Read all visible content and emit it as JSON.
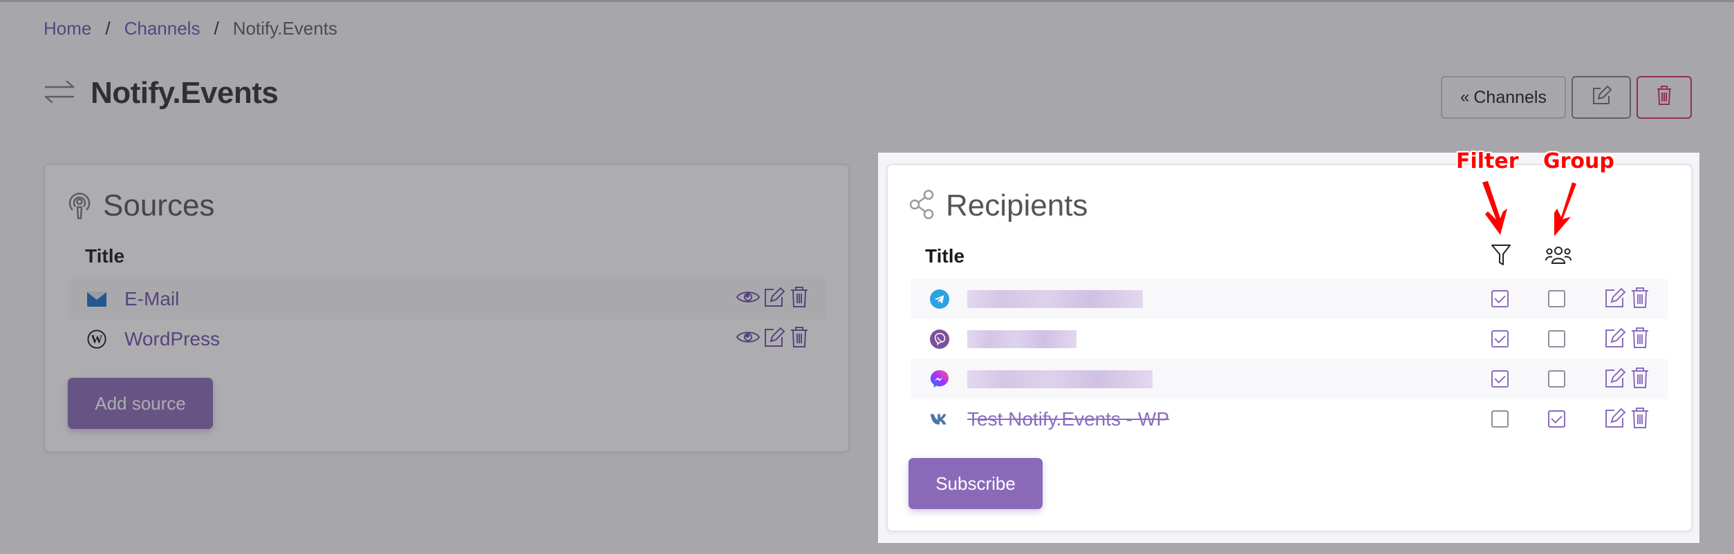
{
  "breadcrumb": {
    "items": [
      {
        "label": "Home",
        "link": true
      },
      {
        "label": "Channels",
        "link": true
      },
      {
        "label": "Notify.Events",
        "link": false
      }
    ],
    "separator": "/"
  },
  "page": {
    "title": "Notify.Events",
    "title_icon": "arrows-exchange-icon"
  },
  "toolbar": {
    "back_label": "Channels",
    "back_icon": "double-chevron-left-icon",
    "edit_icon": "edit-icon",
    "delete_icon": "trash-icon",
    "delete_color": "#d32b74"
  },
  "sources": {
    "heading": "Sources",
    "heading_icon": "broadcast-icon",
    "column_title": "Title",
    "rows": [
      {
        "title": "E-Mail",
        "icon": "envelope-icon",
        "actions": [
          "view",
          "edit",
          "delete"
        ]
      },
      {
        "title": "WordPress",
        "icon": "wordpress-icon",
        "actions": [
          "view",
          "edit",
          "delete"
        ]
      }
    ],
    "add_button": "Add source"
  },
  "recipients": {
    "heading": "Recipients",
    "heading_icon": "share-nodes-icon",
    "column_title": "Title",
    "filter_column_icon": "filter-funnel-icon",
    "group_column_icon": "users-group-icon",
    "rows": [
      {
        "icon": "telegram-icon",
        "title": "",
        "title_blurred": true,
        "filter": true,
        "group": false,
        "disabled": false
      },
      {
        "icon": "viber-icon",
        "title": "",
        "title_blurred": true,
        "filter": true,
        "group": false,
        "disabled": false
      },
      {
        "icon": "messenger-icon",
        "title": "",
        "title_blurred": true,
        "filter": true,
        "group": false,
        "disabled": false
      },
      {
        "icon": "vk-icon",
        "title": "Test Notify.Events - WP",
        "title_blurred": false,
        "filter": false,
        "group": true,
        "disabled": true
      }
    ],
    "subscribe_button": "Subscribe"
  },
  "annotations": {
    "filter_label": "Filter",
    "group_label": "Group",
    "color": "#ff0000"
  },
  "colors": {
    "accent": "#6f4fb0",
    "primary_button": "#8a6ab8",
    "danger": "#d32b74",
    "telegram": "#2aa3df",
    "viber": "#7b519d",
    "vk": "#4a76a8"
  }
}
